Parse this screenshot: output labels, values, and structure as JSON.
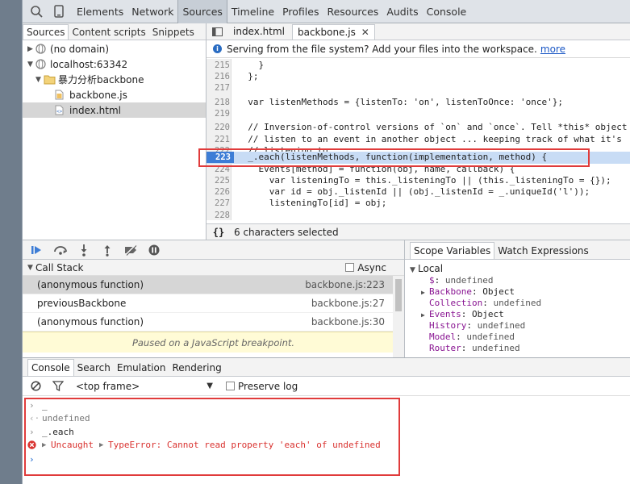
{
  "toolbar": {
    "tabs": [
      "Elements",
      "Network",
      "Sources",
      "Timeline",
      "Profiles",
      "Resources",
      "Audits",
      "Console"
    ]
  },
  "navigator": {
    "tabs": [
      "Sources",
      "Content scripts",
      "Snippets"
    ],
    "tree": [
      "(no domain)",
      "localhost:63342",
      "暴力分析backbone",
      "backbone.js",
      "index.html"
    ]
  },
  "editor": {
    "tabs": [
      "index.html",
      "backbone.js"
    ],
    "info_text": "Serving from the file system? Add your files into the workspace.",
    "info_link": "more",
    "lines": [
      {
        "n": "215",
        "t": "    }"
      },
      {
        "n": "216",
        "t": "  };"
      },
      {
        "n": "217",
        "t": ""
      },
      {
        "n": "218",
        "t": "  var listenMethods = {listenTo: 'on', listenToOnce: 'once'};"
      },
      {
        "n": "219",
        "t": ""
      },
      {
        "n": "220",
        "t": "  // Inversion-of-control versions of `on` and `once`. Tell *this* object to"
      },
      {
        "n": "221",
        "t": "  // listen to an event in another object ... keeping track of what it's"
      },
      {
        "n": "222",
        "t": "  // listening to."
      },
      {
        "n": "223",
        "t": "  _.each(listenMethods, function(implementation, method) {"
      },
      {
        "n": "224",
        "t": "    Events[method] = function(obj, name, callback) {"
      },
      {
        "n": "225",
        "t": "      var listeningTo = this._listeningTo || (this._listeningTo = {});"
      },
      {
        "n": "226",
        "t": "      var id = obj._listenId || (obj._listenId = _.uniqueId('l'));"
      },
      {
        "n": "227",
        "t": "      listeningTo[id] = obj;"
      },
      {
        "n": "228",
        "t": ""
      }
    ],
    "status_braces": "{}",
    "status_text": "6 characters selected"
  },
  "callstack": {
    "title": "Call Stack",
    "async_label": "Async",
    "frames": [
      {
        "fn": "(anonymous function)",
        "loc": "backbone.js:223"
      },
      {
        "fn": "previousBackbone",
        "loc": "backbone.js:27"
      },
      {
        "fn": "(anonymous function)",
        "loc": "backbone.js:30"
      }
    ],
    "paused_text": "Paused on a JavaScript breakpoint."
  },
  "scope": {
    "tabs": [
      "Scope Variables",
      "Watch Expressions"
    ],
    "section": "Local",
    "vars": [
      {
        "arrow": "",
        "key": "$",
        "val": "undefined"
      },
      {
        "arrow": "▶",
        "key": "Backbone",
        "val": "Object"
      },
      {
        "arrow": "",
        "key": "Collection",
        "val": "undefined"
      },
      {
        "arrow": "▶",
        "key": "Events",
        "val": "Object"
      },
      {
        "arrow": "",
        "key": "History",
        "val": "undefined"
      },
      {
        "arrow": "",
        "key": "Model",
        "val": "undefined"
      },
      {
        "arrow": "",
        "key": "Router",
        "val": "undefined"
      }
    ]
  },
  "console": {
    "tabs": [
      "Console",
      "Search",
      "Emulation",
      "Rendering"
    ],
    "frame_select": "<top frame>",
    "preserve_log": "Preserve log",
    "lines": {
      "in1": "_",
      "out1": "undefined",
      "in2": "_.each",
      "err_uncaught": "Uncaught",
      "err_msg": "TypeError: Cannot read property 'each' of undefined"
    }
  },
  "colors": {
    "highlight": "#e03b3b",
    "selected_line": "#3d7dd6"
  }
}
